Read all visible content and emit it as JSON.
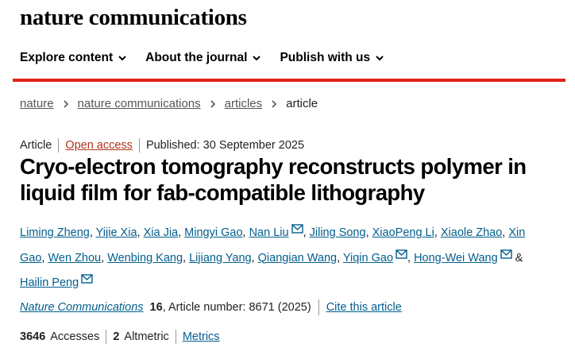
{
  "brand": "nature communications",
  "nav": [
    "Explore content",
    "About the journal",
    "Publish with us"
  ],
  "breadcrumb": [
    "nature",
    "nature communications",
    "articles",
    "article"
  ],
  "article_meta": {
    "type": "Article",
    "access": "Open access",
    "published": "Published: 30 September 2025"
  },
  "title": "Cryo-electron tomography reconstructs polymer in liquid film for fab-compatible lithography",
  "authors": [
    {
      "name": "Liming Zheng",
      "mail": false
    },
    {
      "name": "Yijie Xia",
      "mail": false
    },
    {
      "name": "Xia Jia",
      "mail": false
    },
    {
      "name": "Mingyi Gao",
      "mail": false
    },
    {
      "name": "Nan Liu",
      "mail": true
    },
    {
      "name": "Jiling Song",
      "mail": false
    },
    {
      "name": "XiaoPeng Li",
      "mail": false
    },
    {
      "name": "Xiaole Zhao",
      "mail": false
    },
    {
      "name": "Xin Gao",
      "mail": false
    },
    {
      "name": "Wen Zhou",
      "mail": false
    },
    {
      "name": "Wenbing Kang",
      "mail": false
    },
    {
      "name": "Lijiang Yang",
      "mail": false
    },
    {
      "name": "Qiangian Wang",
      "mail": false
    },
    {
      "name": "Yiqin Gao",
      "mail": true
    },
    {
      "name": "Hong-Wei Wang",
      "mail": true
    },
    {
      "name": "Hailin Peng",
      "mail": true
    }
  ],
  "citation": {
    "journal": "Nature Communications",
    "volume": "16",
    "article_number": ", Article number: 8671 (2025)",
    "cite_label": "Cite this article"
  },
  "metrics": {
    "accesses_count": "3646",
    "accesses_label": "Accesses",
    "altmetric_count": "2",
    "altmetric_label": "Altmetric",
    "metrics_link": "Metrics"
  },
  "colors": {
    "accent_red": "#e2231a",
    "link_blue": "#025e8d",
    "open_access": "#b0341c"
  },
  "icons": [
    "chevron-down-icon",
    "chevron-right-icon",
    "mail-icon"
  ]
}
